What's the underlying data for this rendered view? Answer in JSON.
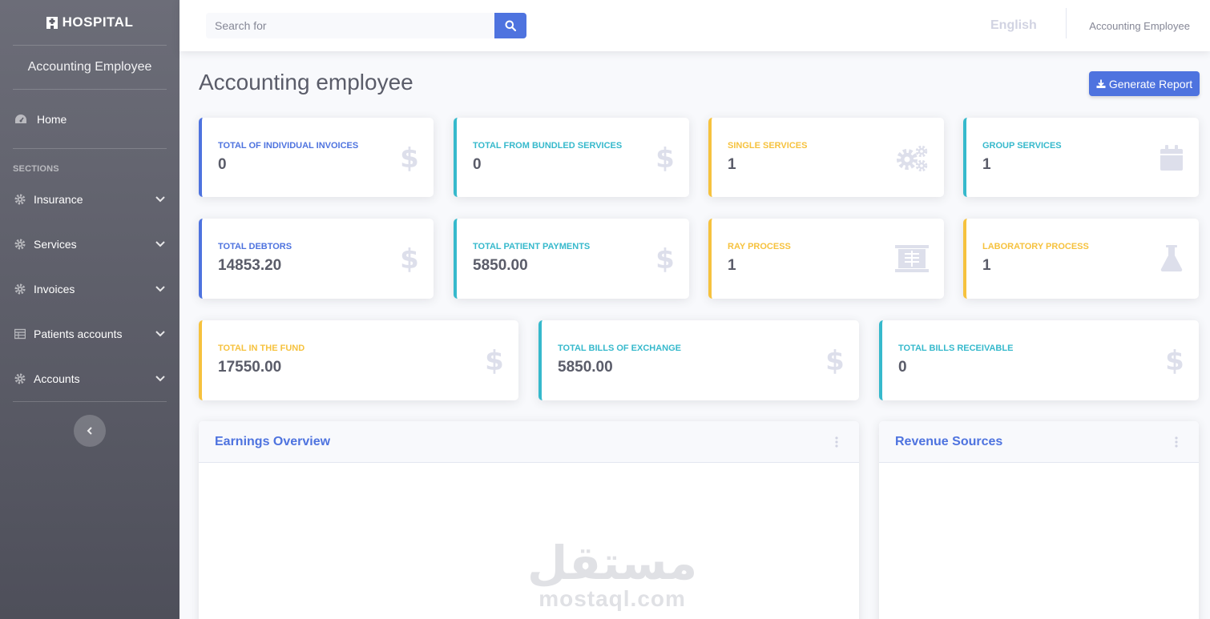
{
  "sidebar": {
    "brand": "HOSPITAL",
    "role": "Accounting Employee",
    "home": "Home",
    "section_heading": "SECTIONS",
    "items": [
      {
        "label": "Insurance",
        "icon": "gear-icon"
      },
      {
        "label": "Services",
        "icon": "gear-icon"
      },
      {
        "label": "Invoices",
        "icon": "gear-icon"
      },
      {
        "label": "Patients accounts",
        "icon": "table-icon"
      },
      {
        "label": "Accounts",
        "icon": "gear-icon"
      }
    ]
  },
  "topbar": {
    "search_placeholder": "Search for",
    "language": "English",
    "user": "Accounting Employee"
  },
  "page": {
    "title": "Accounting employee",
    "generate_button": "Generate Report"
  },
  "cards": [
    {
      "label": "TOTAL OF INDIVIDUAL INVOICES",
      "value": "0",
      "color": "#4e73df",
      "icon": "dollar-icon"
    },
    {
      "label": "TOTAL FROM BUNDLED SERVICES",
      "value": "0",
      "color": "#36b9cc",
      "icon": "dollar-icon"
    },
    {
      "label": "SINGLE SERVICES",
      "value": "1",
      "color": "#f6c23e",
      "icon": "cogs-icon"
    },
    {
      "label": "GROUP SERVICES",
      "value": "1",
      "color": "#36b9cc",
      "icon": "calendar-icon"
    },
    {
      "label": "TOTAL DEBTORS",
      "value": "14853.20",
      "color": "#4e73df",
      "icon": "dollar-icon"
    },
    {
      "label": "TOTAL PATIENT PAYMENTS",
      "value": "5850.00",
      "color": "#36b9cc",
      "icon": "dollar-icon"
    },
    {
      "label": "RAY PROCESS",
      "value": "1",
      "color": "#f6c23e",
      "icon": "x-ray-icon"
    },
    {
      "label": "LABORATORY PROCESS",
      "value": "1",
      "color": "#f6c23e",
      "icon": "flask-icon"
    },
    {
      "label": "TOTAL IN THE FUND",
      "value": "17550.00",
      "color": "#f6c23e",
      "icon": "dollar-icon"
    },
    {
      "label": "TOTAL BILLS OF EXCHANGE",
      "value": "5850.00",
      "color": "#36b9cc",
      "icon": "dollar-icon"
    },
    {
      "label": "TOTAL BILLS RECEIVABLE",
      "value": "0",
      "color": "#36b9cc",
      "icon": "dollar-icon"
    }
  ],
  "panels": {
    "earnings": "Earnings Overview",
    "revenue": "Revenue Sources"
  },
  "watermark": {
    "arabic": "مستقل",
    "latin": "mostaql.com"
  }
}
